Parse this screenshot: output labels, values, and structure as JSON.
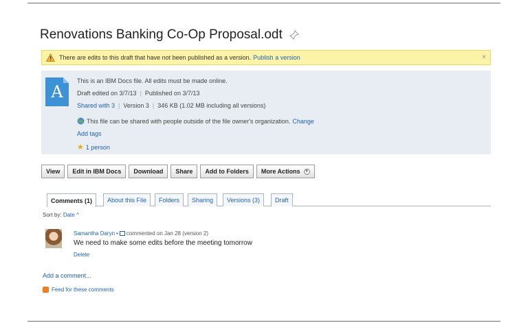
{
  "document": {
    "title": "Renovations Banking Co-Op Proposal.odt",
    "pin_icon": "pin-icon"
  },
  "warning": {
    "text": "There are edits to this draft that have not been published as a version.",
    "link": "Publish a version",
    "close": "×",
    "colors": {
      "background": "#fbf3a8",
      "border": "#ecd95e"
    }
  },
  "info": {
    "icon_letter": "A",
    "icon_color": "#3c92d4",
    "ibm_docs_note": "This is an IBM Docs file. All edits must be made online.",
    "draft_edited": "Draft edited on 3/7/13",
    "published": "Published on 3/7/13",
    "shared_with": "Shared with 3",
    "version": "Version 3",
    "size": "346 KB (1.02 MB including all versions)",
    "external_note": "This file can be shared with people outside of the file owner's organization.",
    "change_link": "Change",
    "add_tags": "Add tags",
    "likes": "1 person"
  },
  "actions": {
    "view": "View",
    "edit": "Edit in IBM Docs",
    "download": "Download",
    "share": "Share",
    "add_to_folders": "Add to Folders",
    "more_actions": "More Actions"
  },
  "tabs": {
    "comments": "Comments (1)",
    "about": "About this File",
    "folders": "Folders",
    "sharing": "Sharing",
    "versions": "Versions (3)",
    "draft": "Draft"
  },
  "comments": {
    "sort_label": "Sort by:",
    "sort_value": "Date",
    "sort_arrow": "^",
    "author": "Samantha Daryn",
    "meta": "commented on Jan 28 (version 2)",
    "body": "We need to make some edits before the meeting tomorrow",
    "delete": "Delete",
    "add_comment": "Add a comment...",
    "feed": "Feed for these comments"
  },
  "accent_colors": {
    "link": "#1f61b8",
    "info_bg": "#e7edf3"
  }
}
